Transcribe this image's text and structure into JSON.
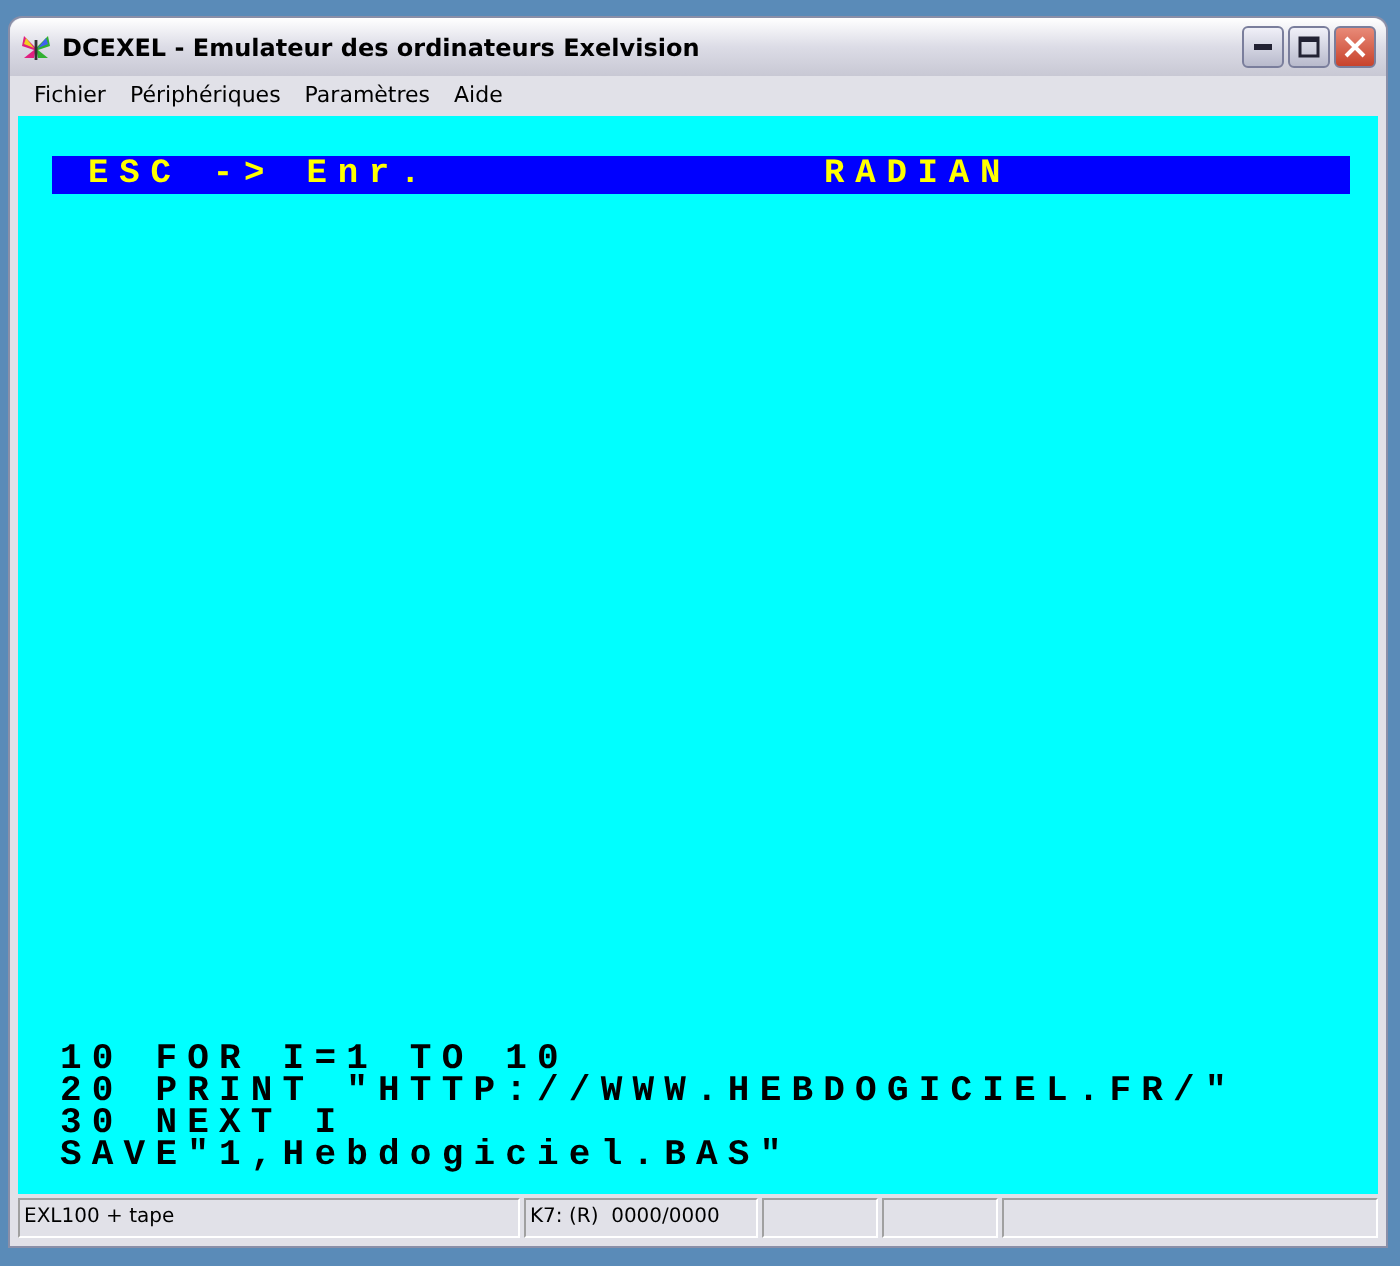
{
  "window": {
    "title": "DCEXEL - Emulateur des ordinateurs Exelvision"
  },
  "menu": [
    {
      "label": "Fichier"
    },
    {
      "label": "Périphériques"
    },
    {
      "label": "Paramètres"
    },
    {
      "label": "Aide"
    }
  ],
  "screen": {
    "header": [
      "ESC -> Enr.",
      "RADIAN"
    ],
    "lines": [
      "10 FOR I=1 TO 10",
      "20 PRINT \"HTTP://WWW.HEBDOGICIEL.FR/\"",
      "30 NEXT I",
      "SAVE\"1,Hebdogiciel.BAS\""
    ]
  },
  "status_bar": [
    "EXL100 + tape",
    "K7: (R)  0000/0000"
  ]
}
